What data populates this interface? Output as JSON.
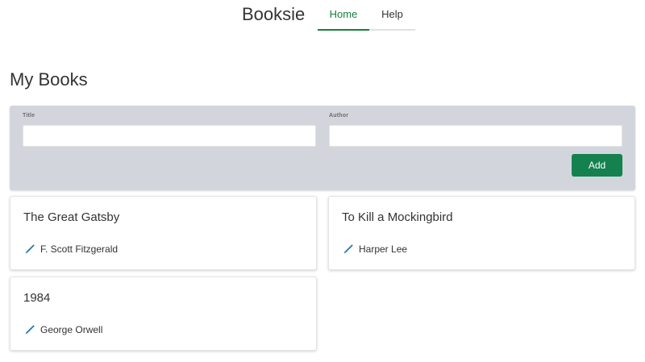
{
  "app": {
    "brand": "Booksie"
  },
  "nav": {
    "tabs": [
      {
        "label": "Home",
        "active": true
      },
      {
        "label": "Help",
        "active": false
      }
    ]
  },
  "page": {
    "title": "My Books"
  },
  "form": {
    "title_label": "Title",
    "title_value": "",
    "author_label": "Author",
    "author_value": "",
    "add_label": "Add"
  },
  "books": [
    {
      "title": "The Great Gatsby",
      "author": "F. Scott Fitzgerald"
    },
    {
      "title": "To Kill a Mockingbird",
      "author": "Harper Lee"
    },
    {
      "title": "1984",
      "author": "George Orwell"
    }
  ],
  "icons": {
    "author": "pen-icon"
  },
  "colors": {
    "accent": "#15803d",
    "button": "#15814f",
    "panel": "#d2d6dc",
    "icon": "#2a7ab0"
  }
}
